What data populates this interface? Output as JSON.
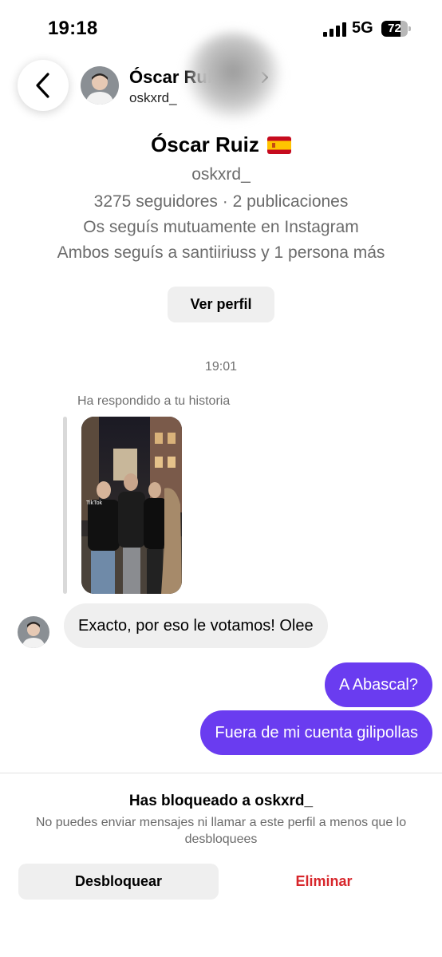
{
  "status_bar": {
    "time": "19:18",
    "network": "5G",
    "battery_level": "72"
  },
  "header": {
    "name": "Óscar Ruiz",
    "flag": "🇪🇸",
    "username": "oskxrd_"
  },
  "profile": {
    "name": "Óscar Ruiz",
    "username": "oskxrd_",
    "stats": "3275 seguidores · 2 publicaciones",
    "mutual_follow": "Os seguís mutuamente en Instagram",
    "shared_follows": "Ambos seguís a santiiriuss y 1 persona más",
    "view_profile_label": "Ver perfil"
  },
  "chat": {
    "timestamp": "19:01",
    "story_reply_caption": "Ha respondido a tu historia",
    "messages": [
      {
        "from": "them",
        "text": "Exacto, por eso le votamos! Olee"
      },
      {
        "from": "me",
        "text": "A Abascal?"
      },
      {
        "from": "me",
        "text": "Fuera de mi cuenta gilipollas"
      }
    ]
  },
  "blocked": {
    "title": "Has bloqueado a oskxrd_",
    "description": "No puedes enviar mensajes ni llamar a este perfil a menos que lo desbloquees",
    "unblock_label": "Desbloquear",
    "delete_label": "Eliminar"
  },
  "colors": {
    "accent_bubble": "#6a3cf0",
    "danger": "#d7262b",
    "muted_text": "#6b6b6b",
    "button_bg": "#efefef"
  }
}
